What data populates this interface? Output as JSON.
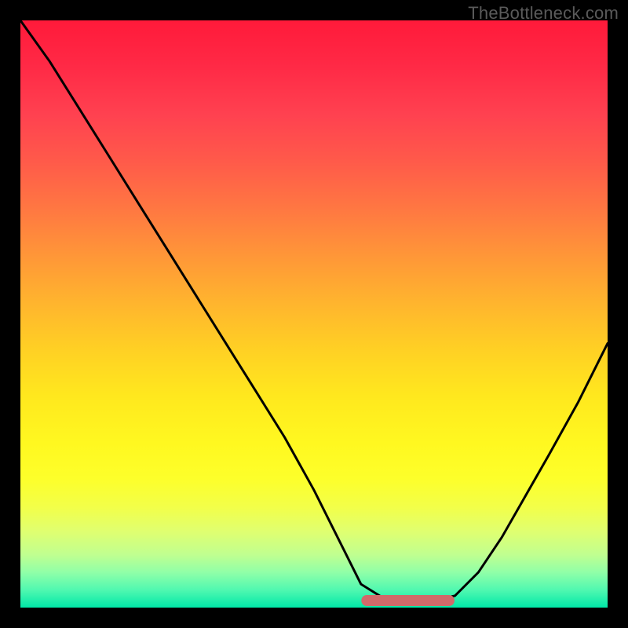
{
  "watermark": "TheBottleneck.com",
  "chart_data": {
    "type": "line",
    "title": "",
    "xlabel": "",
    "ylabel": "",
    "xlim": [
      0,
      1
    ],
    "ylim": [
      0,
      1
    ],
    "background_gradient": {
      "top": "#ff1a3a",
      "mid": "#ffd024",
      "bottom": "#00e8a8",
      "meaning": "red(high) → green(low) bottleneck severity"
    },
    "series": [
      {
        "name": "bottleneck-curve",
        "color": "#000000",
        "x": [
          0.0,
          0.05,
          0.1,
          0.15,
          0.2,
          0.25,
          0.3,
          0.35,
          0.4,
          0.45,
          0.5,
          0.55,
          0.58,
          0.62,
          0.66,
          0.7,
          0.74,
          0.78,
          0.82,
          0.86,
          0.9,
          0.95,
          1.0
        ],
        "y": [
          1.0,
          0.93,
          0.85,
          0.77,
          0.69,
          0.61,
          0.53,
          0.45,
          0.37,
          0.29,
          0.2,
          0.1,
          0.04,
          0.015,
          0.012,
          0.012,
          0.02,
          0.06,
          0.12,
          0.19,
          0.26,
          0.35,
          0.45
        ]
      },
      {
        "name": "optimal-band",
        "color": "#d16a6a",
        "note": "flat rounded segment at valley floor marking optimal range",
        "x": [
          0.59,
          0.73
        ],
        "y": [
          0.012,
          0.012
        ]
      }
    ]
  }
}
